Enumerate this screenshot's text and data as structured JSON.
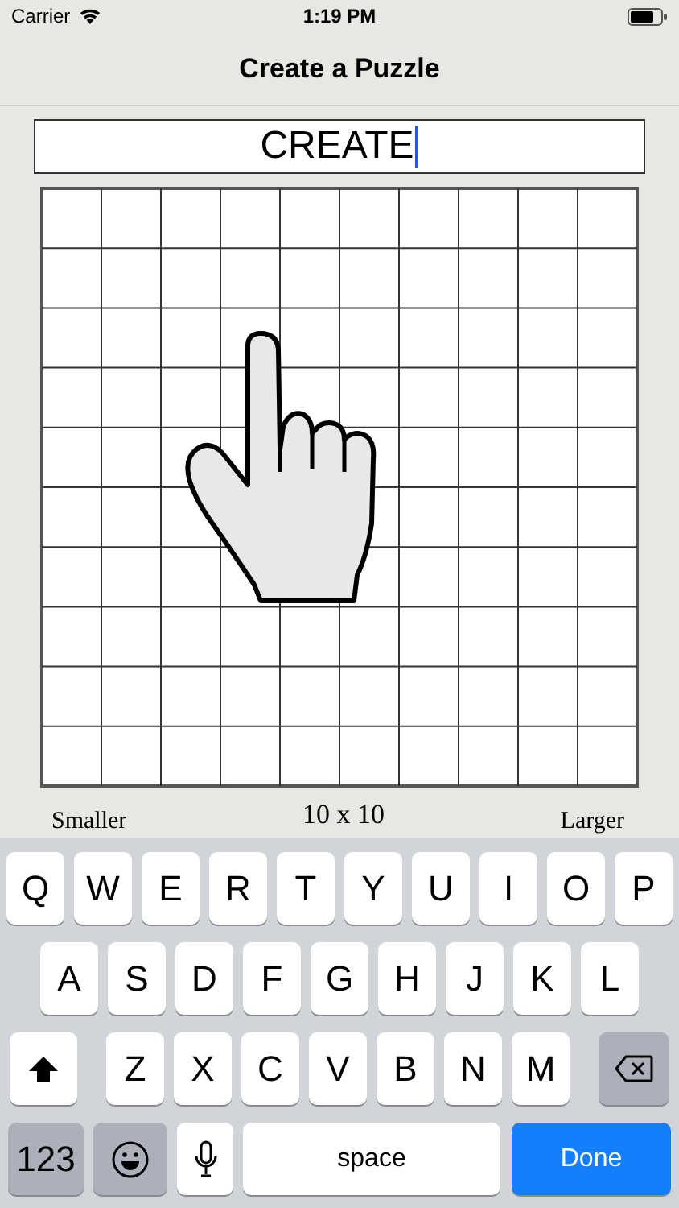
{
  "status_bar": {
    "carrier": "Carrier",
    "time": "1:19 PM"
  },
  "nav_bar": {
    "title": "Create a Puzzle"
  },
  "word_field": {
    "value": "CREATE",
    "focused": true
  },
  "size_control": {
    "smaller": "Smaller",
    "size": "10 x 10",
    "larger": "Larger"
  },
  "keyboard": {
    "key_rows": [
      {
        "keys": [
          {
            "kind": "letter",
            "label": "Q"
          },
          {
            "kind": "letter",
            "label": "W"
          },
          {
            "kind": "letter",
            "label": "E"
          },
          {
            "kind": "letter",
            "label": "R"
          },
          {
            "kind": "letter",
            "label": "T"
          },
          {
            "kind": "letter",
            "label": "Y"
          },
          {
            "kind": "letter",
            "label": "U"
          },
          {
            "kind": "letter",
            "label": "I"
          },
          {
            "kind": "letter",
            "label": "O"
          },
          {
            "kind": "letter",
            "label": "P"
          }
        ]
      },
      {
        "keys": [
          {
            "kind": "letter",
            "label": "A"
          },
          {
            "kind": "letter",
            "label": "S"
          },
          {
            "kind": "letter",
            "label": "D"
          },
          {
            "kind": "letter",
            "label": "F"
          },
          {
            "kind": "letter",
            "label": "G"
          },
          {
            "kind": "letter",
            "label": "H"
          },
          {
            "kind": "letter",
            "label": "J"
          },
          {
            "kind": "letter",
            "label": "K"
          },
          {
            "kind": "letter",
            "label": "L"
          }
        ]
      },
      {
        "keys": [
          {
            "kind": "shift"
          },
          {
            "kind": "letter",
            "label": "Z"
          },
          {
            "kind": "letter",
            "label": "X"
          },
          {
            "kind": "letter",
            "label": "C"
          },
          {
            "kind": "letter",
            "label": "V"
          },
          {
            "kind": "letter",
            "label": "B"
          },
          {
            "kind": "letter",
            "label": "N"
          },
          {
            "kind": "letter",
            "label": "M"
          },
          {
            "kind": "delete"
          }
        ]
      },
      {
        "keys": [
          {
            "kind": "mode",
            "label": "123"
          },
          {
            "kind": "emoji"
          },
          {
            "kind": "mic"
          },
          {
            "kind": "space",
            "label": "space"
          },
          {
            "kind": "done",
            "label": "Done"
          }
        ]
      }
    ]
  }
}
